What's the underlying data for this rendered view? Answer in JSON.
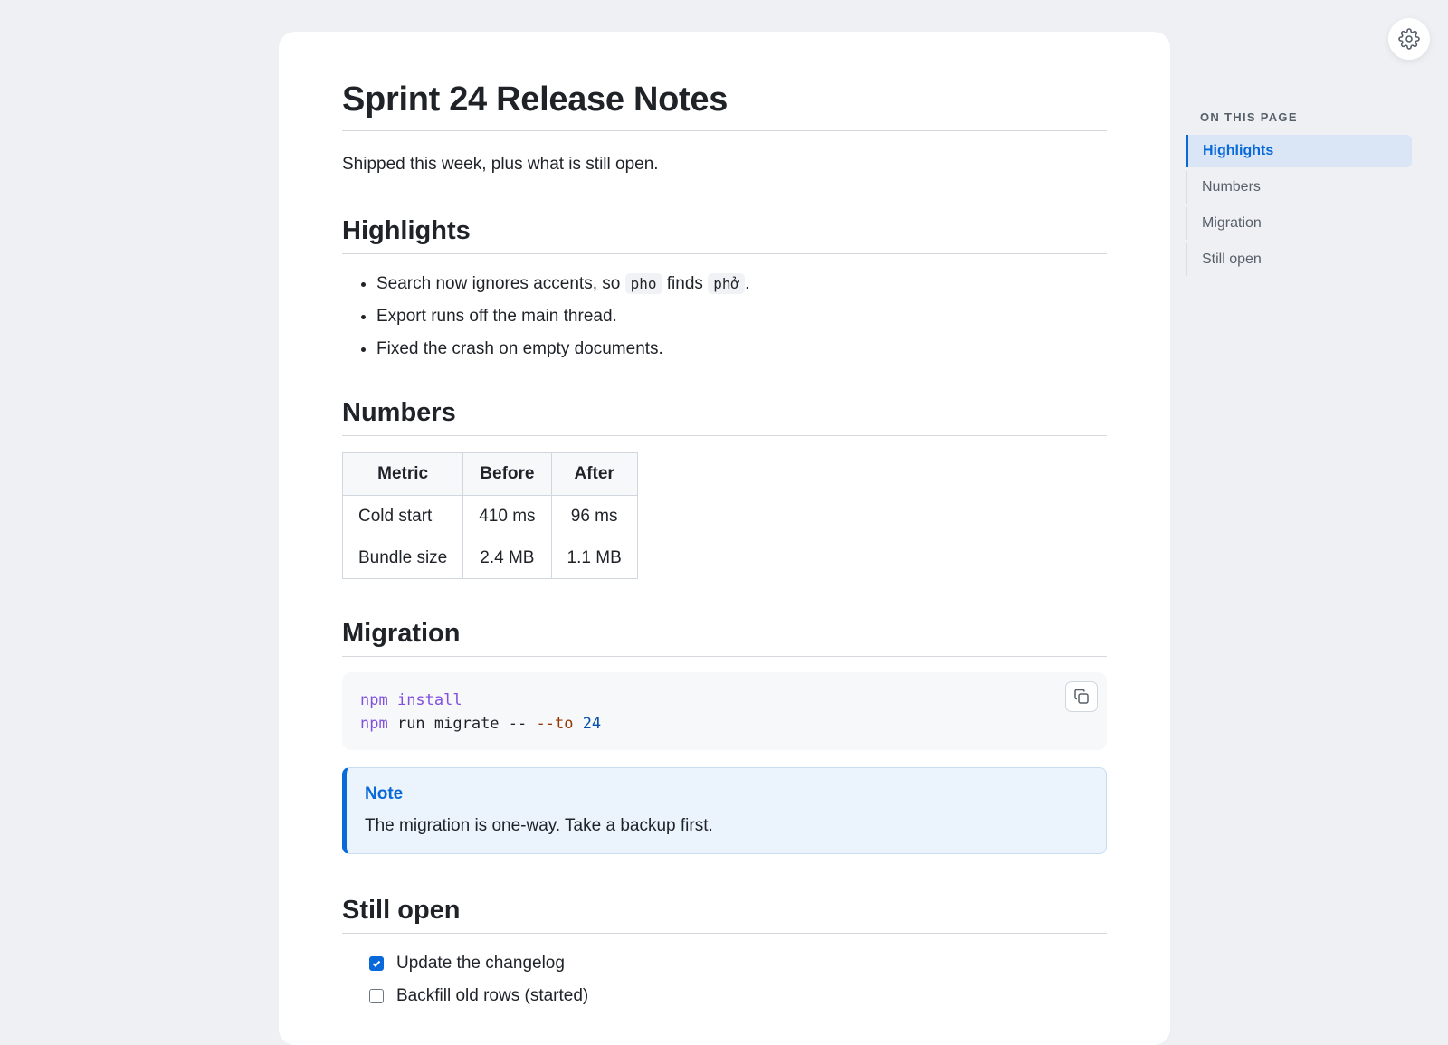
{
  "doc": {
    "title": "Sprint 24 Release Notes",
    "subtitle": "Shipped this week, plus what is still open."
  },
  "highlights": {
    "heading": "Highlights",
    "item1": {
      "before": "Search now ignores accents, so ",
      "code1": "pho",
      "middle": " finds ",
      "code2": "phở",
      "after": "."
    },
    "item2": "Export runs off the main thread.",
    "item3": "Fixed the crash on empty documents."
  },
  "numbers": {
    "heading": "Numbers",
    "columns": [
      "Metric",
      "Before",
      "After"
    ],
    "rows": [
      [
        "Cold start",
        "410 ms",
        "96 ms"
      ],
      [
        "Bundle size",
        "2.4 MB",
        "1.1 MB"
      ]
    ]
  },
  "migration": {
    "heading": "Migration",
    "code": {
      "line1": {
        "cmd": "npm",
        "sub": " install"
      },
      "line2": {
        "cmd": "npm",
        "rest": " run migrate -- ",
        "flag": "--to",
        "space": " ",
        "num": "24"
      }
    },
    "callout": {
      "title": "Note",
      "body": "The migration is one-way. Take a backup first."
    }
  },
  "still_open": {
    "heading": "Still open",
    "tasks": [
      {
        "label": "Update the changelog",
        "checked": true
      },
      {
        "label": "Backfill old rows (started)",
        "checked": false
      }
    ]
  },
  "toc": {
    "heading": "ON THIS PAGE",
    "items": [
      "Highlights",
      "Numbers",
      "Migration",
      "Still open"
    ],
    "active": "Highlights"
  },
  "colors": {
    "accent": "#0969da",
    "page_bg": "#eef0f4",
    "card_bg": "#ffffff"
  },
  "icons": {
    "settings": "gear-icon",
    "copy": "copy-icon",
    "check": "check-icon"
  }
}
